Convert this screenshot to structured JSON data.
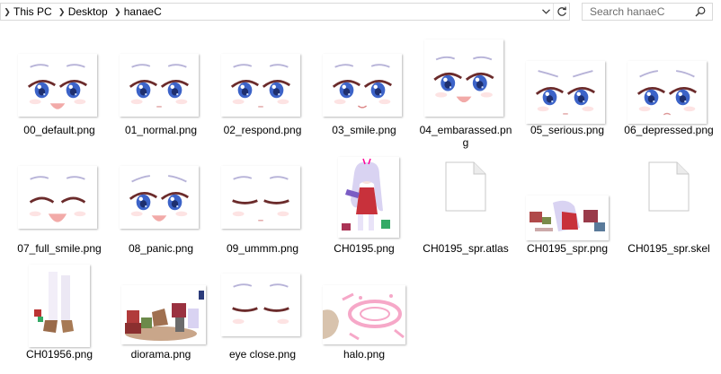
{
  "address_bar": {
    "crumbs": [
      "This PC",
      "Desktop",
      "hanaeC"
    ],
    "dropdown_icon": "chevron-down-icon",
    "refresh_icon": "refresh-icon"
  },
  "search": {
    "placeholder": "Search hanaeC",
    "icon": "search-icon"
  },
  "files": [
    {
      "name": "00_default.png",
      "kind": "face",
      "expr": "default"
    },
    {
      "name": "01_normal.png",
      "kind": "face",
      "expr": "normal"
    },
    {
      "name": "02_respond.png",
      "kind": "face",
      "expr": "respond"
    },
    {
      "name": "03_smile.png",
      "kind": "face",
      "expr": "smile"
    },
    {
      "name": "04_embarassed.png",
      "kind": "face",
      "expr": "embarassed"
    },
    {
      "name": "05_serious.png",
      "kind": "face",
      "expr": "serious"
    },
    {
      "name": "06_depressed.png",
      "kind": "face",
      "expr": "depressed"
    },
    {
      "name": "07_full_smile.png",
      "kind": "face",
      "expr": "fullsmile"
    },
    {
      "name": "08_panic.png",
      "kind": "face",
      "expr": "panic"
    },
    {
      "name": "09_ummm.png",
      "kind": "face",
      "expr": "ummm"
    },
    {
      "name": "CH0195.png",
      "kind": "character"
    },
    {
      "name": "CH0195_spr.atlas",
      "kind": "document"
    },
    {
      "name": "CH0195_spr.png",
      "kind": "sprite"
    },
    {
      "name": "CH0195_spr.skel",
      "kind": "document"
    },
    {
      "name": "CH01956.png",
      "kind": "legs"
    },
    {
      "name": "diorama.png",
      "kind": "diorama"
    },
    {
      "name": "eye close.png",
      "kind": "face",
      "expr": "eyeclose"
    },
    {
      "name": "halo.png",
      "kind": "halo"
    }
  ],
  "colors": {
    "iris": "#3c63c8",
    "eyelash": "#6b2b2b",
    "mouth": "#f2aaa8",
    "halo": "#f6a8c8",
    "border": "#d9d9d9"
  }
}
